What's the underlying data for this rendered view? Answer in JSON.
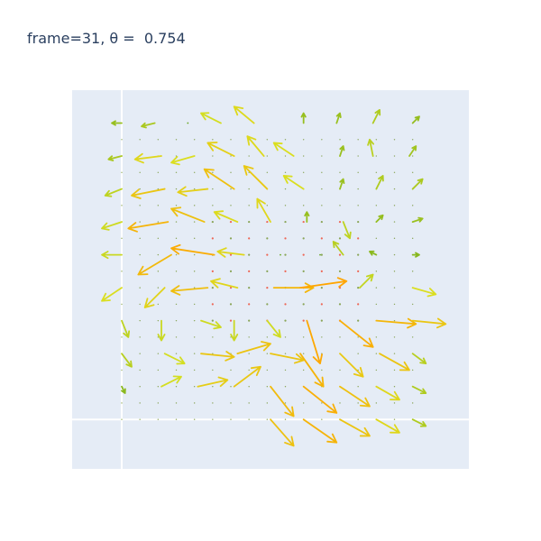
{
  "chart_data": {
    "type": "quiver",
    "title": "frame=31, θ =  0.754",
    "xlabel": "",
    "ylabel": "",
    "xlim": [
      -0.15,
      1.05
    ],
    "ylim": [
      -0.15,
      1.0
    ],
    "zero_lines": {
      "x": 0,
      "y": 0
    },
    "grid": false,
    "legend": "none",
    "colors": {
      "plot_bg": "#e5ecf6",
      "zero_line": "#ffffff",
      "title": "#2a3f5f",
      "low": "#66a61e",
      "mid": "#d9e021",
      "high": "#ffa500",
      "dot": "#f03b20"
    },
    "arrow_grid_note": "",
    "arrows": [
      {
        "x": 0.0,
        "y": 0.9,
        "u": -0.03,
        "v": 0.0
      },
      {
        "x": 0.1,
        "y": 0.9,
        "u": -0.04,
        "v": -0.01
      },
      {
        "x": 0.2,
        "y": 0.9,
        "u": 0.0,
        "v": 0.0
      },
      {
        "x": 0.3,
        "y": 0.9,
        "u": -0.06,
        "v": 0.03
      },
      {
        "x": 0.4,
        "y": 0.9,
        "u": -0.06,
        "v": 0.05
      },
      {
        "x": 0.55,
        "y": 0.9,
        "u": 0.0,
        "v": 0.03
      },
      {
        "x": 0.65,
        "y": 0.9,
        "u": 0.01,
        "v": 0.03
      },
      {
        "x": 0.76,
        "y": 0.9,
        "u": 0.02,
        "v": 0.04
      },
      {
        "x": 0.88,
        "y": 0.9,
        "u": 0.02,
        "v": 0.02
      },
      {
        "x": 0.0,
        "y": 0.8,
        "u": -0.04,
        "v": -0.01
      },
      {
        "x": 0.12,
        "y": 0.8,
        "u": -0.08,
        "v": -0.01
      },
      {
        "x": 0.22,
        "y": 0.8,
        "u": -0.07,
        "v": -0.02
      },
      {
        "x": 0.34,
        "y": 0.8,
        "u": -0.08,
        "v": 0.04
      },
      {
        "x": 0.43,
        "y": 0.8,
        "u": -0.05,
        "v": 0.06
      },
      {
        "x": 0.52,
        "y": 0.8,
        "u": -0.06,
        "v": 0.04
      },
      {
        "x": 0.66,
        "y": 0.8,
        "u": 0.01,
        "v": 0.03
      },
      {
        "x": 0.76,
        "y": 0.8,
        "u": -0.01,
        "v": 0.05
      },
      {
        "x": 0.87,
        "y": 0.8,
        "u": 0.02,
        "v": 0.03
      },
      {
        "x": 0.0,
        "y": 0.7,
        "u": -0.05,
        "v": -0.02
      },
      {
        "x": 0.13,
        "y": 0.7,
        "u": -0.1,
        "v": -0.02
      },
      {
        "x": 0.26,
        "y": 0.7,
        "u": -0.09,
        "v": -0.01
      },
      {
        "x": 0.34,
        "y": 0.7,
        "u": -0.09,
        "v": 0.06
      },
      {
        "x": 0.44,
        "y": 0.7,
        "u": -0.07,
        "v": 0.07
      },
      {
        "x": 0.55,
        "y": 0.7,
        "u": -0.06,
        "v": 0.04
      },
      {
        "x": 0.66,
        "y": 0.7,
        "u": 0.01,
        "v": 0.03
      },
      {
        "x": 0.77,
        "y": 0.7,
        "u": 0.02,
        "v": 0.04
      },
      {
        "x": 0.88,
        "y": 0.7,
        "u": 0.03,
        "v": 0.03
      },
      {
        "x": 0.0,
        "y": 0.6,
        "u": -0.06,
        "v": -0.02
      },
      {
        "x": 0.14,
        "y": 0.6,
        "u": -0.12,
        "v": -0.02
      },
      {
        "x": 0.25,
        "y": 0.6,
        "u": -0.1,
        "v": 0.04
      },
      {
        "x": 0.35,
        "y": 0.6,
        "u": -0.07,
        "v": 0.03
      },
      {
        "x": 0.45,
        "y": 0.6,
        "u": -0.04,
        "v": 0.07
      },
      {
        "x": 0.56,
        "y": 0.6,
        "u": 0.0,
        "v": 0.03
      },
      {
        "x": 0.67,
        "y": 0.6,
        "u": 0.02,
        "v": -0.05
      },
      {
        "x": 0.77,
        "y": 0.6,
        "u": 0.02,
        "v": 0.02
      },
      {
        "x": 0.88,
        "y": 0.6,
        "u": 0.03,
        "v": 0.01
      },
      {
        "x": 0.0,
        "y": 0.5,
        "u": -0.06,
        "v": 0.0
      },
      {
        "x": 0.15,
        "y": 0.5,
        "u": -0.1,
        "v": -0.06
      },
      {
        "x": 0.28,
        "y": 0.5,
        "u": -0.13,
        "v": 0.02
      },
      {
        "x": 0.37,
        "y": 0.5,
        "u": -0.08,
        "v": 0.01
      },
      {
        "x": 0.48,
        "y": 0.5,
        "u": 0.0,
        "v": 0.0
      },
      {
        "x": 0.6,
        "y": 0.5,
        "u": 0.0,
        "v": 0.0
      },
      {
        "x": 0.67,
        "y": 0.5,
        "u": -0.03,
        "v": 0.04
      },
      {
        "x": 0.77,
        "y": 0.5,
        "u": -0.02,
        "v": 0.01
      },
      {
        "x": 0.88,
        "y": 0.5,
        "u": 0.02,
        "v": 0.0
      },
      {
        "x": 0.0,
        "y": 0.4,
        "u": -0.06,
        "v": -0.04
      },
      {
        "x": 0.13,
        "y": 0.4,
        "u": -0.06,
        "v": -0.06
      },
      {
        "x": 0.26,
        "y": 0.4,
        "u": -0.11,
        "v": -0.01
      },
      {
        "x": 0.35,
        "y": 0.4,
        "u": -0.08,
        "v": 0.02
      },
      {
        "x": 0.46,
        "y": 0.4,
        "u": 0.12,
        "v": 0.0
      },
      {
        "x": 0.54,
        "y": 0.4,
        "u": 0.14,
        "v": 0.02
      },
      {
        "x": 0.72,
        "y": 0.4,
        "u": 0.04,
        "v": 0.04
      },
      {
        "x": 0.88,
        "y": 0.4,
        "u": 0.07,
        "v": -0.02
      },
      {
        "x": 0.0,
        "y": 0.3,
        "u": 0.02,
        "v": -0.05
      },
      {
        "x": 0.12,
        "y": 0.3,
        "u": 0.0,
        "v": -0.06
      },
      {
        "x": 0.24,
        "y": 0.3,
        "u": 0.06,
        "v": -0.02
      },
      {
        "x": 0.34,
        "y": 0.3,
        "u": 0.0,
        "v": -0.06
      },
      {
        "x": 0.44,
        "y": 0.3,
        "u": 0.04,
        "v": -0.05
      },
      {
        "x": 0.56,
        "y": 0.3,
        "u": 0.04,
        "v": -0.13
      },
      {
        "x": 0.66,
        "y": 0.3,
        "u": 0.1,
        "v": -0.08
      },
      {
        "x": 0.77,
        "y": 0.3,
        "u": 0.12,
        "v": -0.01
      },
      {
        "x": 0.88,
        "y": 0.3,
        "u": 0.1,
        "v": -0.01
      },
      {
        "x": 0.0,
        "y": 0.2,
        "u": 0.03,
        "v": -0.04
      },
      {
        "x": 0.13,
        "y": 0.2,
        "u": 0.06,
        "v": -0.03
      },
      {
        "x": 0.24,
        "y": 0.2,
        "u": 0.1,
        "v": -0.01
      },
      {
        "x": 0.35,
        "y": 0.2,
        "u": 0.1,
        "v": 0.03
      },
      {
        "x": 0.45,
        "y": 0.2,
        "u": 0.1,
        "v": -0.02
      },
      {
        "x": 0.54,
        "y": 0.2,
        "u": 0.07,
        "v": -0.1
      },
      {
        "x": 0.66,
        "y": 0.2,
        "u": 0.07,
        "v": -0.07
      },
      {
        "x": 0.78,
        "y": 0.2,
        "u": 0.09,
        "v": -0.05
      },
      {
        "x": 0.88,
        "y": 0.2,
        "u": 0.04,
        "v": -0.03
      },
      {
        "x": 0.0,
        "y": 0.1,
        "u": 0.01,
        "v": -0.02
      },
      {
        "x": 0.12,
        "y": 0.1,
        "u": 0.06,
        "v": 0.03
      },
      {
        "x": 0.23,
        "y": 0.1,
        "u": 0.09,
        "v": 0.02
      },
      {
        "x": 0.34,
        "y": 0.1,
        "u": 0.08,
        "v": 0.06
      },
      {
        "x": 0.45,
        "y": 0.1,
        "u": 0.07,
        "v": -0.09
      },
      {
        "x": 0.55,
        "y": 0.1,
        "u": 0.1,
        "v": -0.08
      },
      {
        "x": 0.66,
        "y": 0.1,
        "u": 0.09,
        "v": -0.06
      },
      {
        "x": 0.77,
        "y": 0.1,
        "u": 0.07,
        "v": -0.04
      },
      {
        "x": 0.88,
        "y": 0.1,
        "u": 0.04,
        "v": -0.02
      },
      {
        "x": 0.45,
        "y": 0.0,
        "u": 0.07,
        "v": -0.08
      },
      {
        "x": 0.55,
        "y": 0.0,
        "u": 0.1,
        "v": -0.07
      },
      {
        "x": 0.66,
        "y": 0.0,
        "u": 0.09,
        "v": -0.05
      },
      {
        "x": 0.77,
        "y": 0.0,
        "u": 0.07,
        "v": -0.04
      },
      {
        "x": 0.88,
        "y": 0.0,
        "u": 0.04,
        "v": -0.02
      }
    ],
    "dots": {
      "x_start": 0.0,
      "x_step": 0.055,
      "x_count": 17,
      "y_start": 0.0,
      "y_step": 0.05,
      "y_count": 18
    }
  }
}
